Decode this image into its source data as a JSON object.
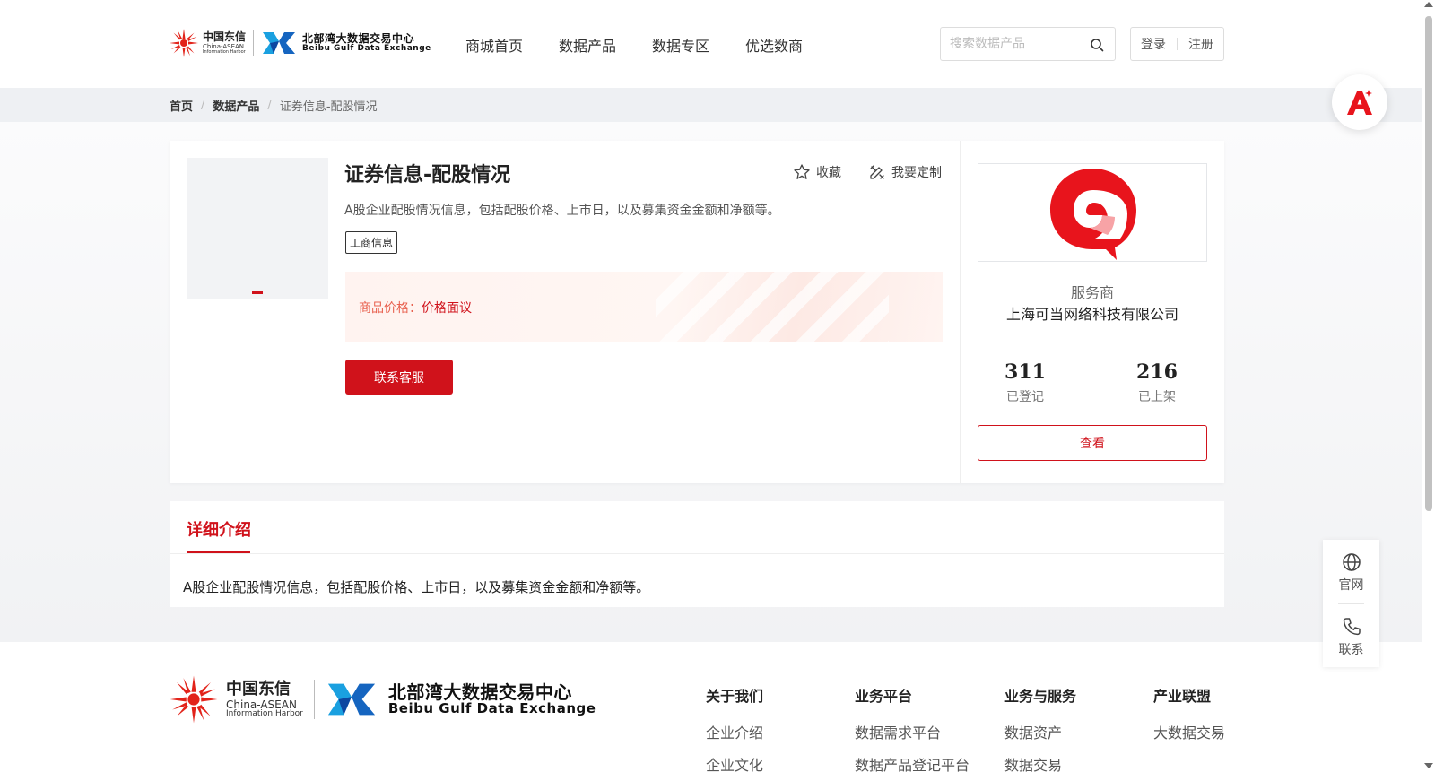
{
  "header": {
    "logo": {
      "cn_name": "中国东信",
      "cn_en1": "China-ASEAN",
      "cn_en2": "Information Harbor",
      "bbg_name": "北部湾大数据交易中心",
      "bbg_en": "Beibu Gulf Data Exchange"
    },
    "nav": [
      "商城首页",
      "数据产品",
      "数据专区",
      "优选数商"
    ],
    "search": {
      "placeholder": "搜索数据产品",
      "value": ""
    },
    "auth": {
      "login": "登录",
      "register": "注册"
    }
  },
  "breadcrumb": {
    "home": "首页",
    "category": "数据产品",
    "current": "证券信息-配股情况"
  },
  "product": {
    "title": "证券信息-配股情况",
    "favorite_label": "收藏",
    "customize_label": "我要定制",
    "description": "A股企业配股情况信息，包括配股价格、上市日，以及募集资金金额和净额等。",
    "tag": "工商信息",
    "price_label": "商品价格：",
    "price_value": "价格面议",
    "contact_button": "联系客服"
  },
  "provider": {
    "label": "服务商",
    "name": "上海可当网络科技有限公司",
    "registered_count": "311",
    "registered_label": "已登记",
    "listed_count": "216",
    "listed_label": "已上架",
    "view_button": "查看",
    "brand_color": "#e8141c"
  },
  "detail": {
    "tab_label": "详细介绍",
    "text": "A股企业配股情况信息，包括配股价格、上市日，以及募集资金金额和净额等。"
  },
  "footer": {
    "columns": [
      {
        "heading": "关于我们",
        "items": [
          "企业介绍",
          "企业文化"
        ]
      },
      {
        "heading": "业务平台",
        "items": [
          "数据需求平台",
          "数据产品登记平台"
        ]
      },
      {
        "heading": "业务与服务",
        "items": [
          "数据资产",
          "数据交易"
        ]
      },
      {
        "heading": "产业联盟",
        "items": [
          "大数据交易"
        ]
      }
    ]
  },
  "side_tools": {
    "website_label": "官网",
    "contact_label": "联系"
  },
  "colors": {
    "accent": "#d0121b",
    "price_text": "#e8614f"
  }
}
